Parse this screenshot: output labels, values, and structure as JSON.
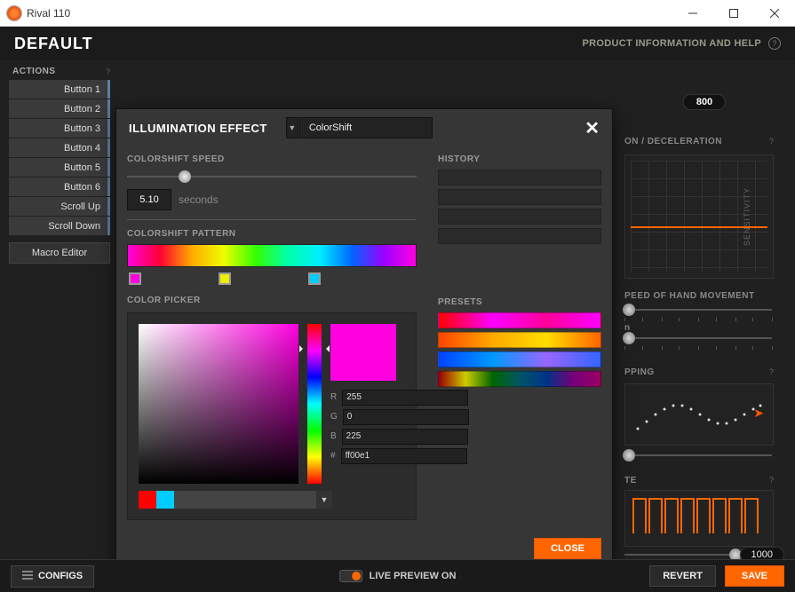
{
  "window": {
    "title": "Rival 110"
  },
  "header": {
    "profile": "DEFAULT",
    "info_link": "PRODUCT INFORMATION AND HELP"
  },
  "sidebar": {
    "label": "ACTIONS",
    "items": [
      "Button 1",
      "Button 2",
      "Button 3",
      "Button 4",
      "Button 5",
      "Button 6",
      "Scroll Up",
      "Scroll Down"
    ],
    "macro_btn": "Macro Editor"
  },
  "right": {
    "cpi_value": "800",
    "accdec_label": "ON / DECELERATION",
    "sensitivity_label": "SENSITIVITY",
    "speed_label": "PEED OF HAND MOVEMENT",
    "on_label": "n",
    "snapping_label": "PPING",
    "polling_label": "TE",
    "polling_value": "1000"
  },
  "modal": {
    "title": "ILLUMINATION EFFECT",
    "effect_selected": "ColorShift",
    "speed_label": "COLORSHIFT SPEED",
    "speed_value": "5.10",
    "speed_unit": "seconds",
    "pattern_label": "COLORSHIFT PATTERN",
    "picker_label": "COLOR PICKER",
    "history_label": "HISTORY",
    "presets_label": "PRESETS",
    "rgb": {
      "r_label": "R",
      "g_label": "G",
      "b_label": "B",
      "hex_label": "#",
      "r": "255",
      "g": "0",
      "b": "225",
      "hex": "ff00e1"
    },
    "markers": [
      "#ff00e1",
      "#eeee00",
      "#00ccff"
    ],
    "close": "CLOSE"
  },
  "bottom": {
    "configs": "CONFIGS",
    "live_preview": "LIVE PREVIEW ON",
    "revert": "REVERT",
    "save": "SAVE"
  }
}
